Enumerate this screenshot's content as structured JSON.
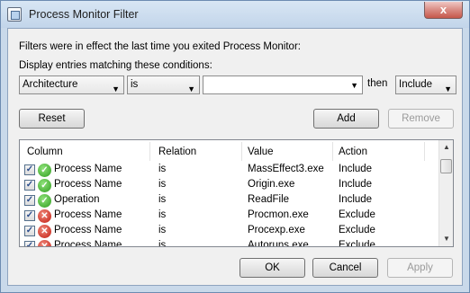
{
  "window": {
    "title": "Process Monitor Filter",
    "close_label": "x"
  },
  "intro_text": "Filters were in effect the last time you exited Process Monitor:",
  "display_label": "Display entries matching these conditions:",
  "condition": {
    "column": "Architecture",
    "relation": "is",
    "value": "",
    "then_label": "then",
    "action": "Include"
  },
  "buttons": {
    "reset": "Reset",
    "add": "Add",
    "remove": "Remove",
    "ok": "OK",
    "cancel": "Cancel",
    "apply": "Apply"
  },
  "table": {
    "headers": [
      "Column",
      "Relation",
      "Value",
      "Action"
    ],
    "rows": [
      {
        "column": "Process Name",
        "relation": "is",
        "value": "MassEffect3.exe",
        "action": "Include",
        "checked": true,
        "status": "include"
      },
      {
        "column": "Process Name",
        "relation": "is",
        "value": "Origin.exe",
        "action": "Include",
        "checked": true,
        "status": "include"
      },
      {
        "column": "Operation",
        "relation": "is",
        "value": "ReadFile",
        "action": "Include",
        "checked": true,
        "status": "include"
      },
      {
        "column": "Process Name",
        "relation": "is",
        "value": "Procmon.exe",
        "action": "Exclude",
        "checked": true,
        "status": "exclude"
      },
      {
        "column": "Process Name",
        "relation": "is",
        "value": "Procexp.exe",
        "action": "Exclude",
        "checked": true,
        "status": "exclude"
      },
      {
        "column": "Process Name",
        "relation": "is",
        "value": "Autoruns.exe",
        "action": "Exclude",
        "checked": true,
        "status": "exclude"
      }
    ]
  },
  "glyphs": {
    "check": "✓",
    "include": "✓",
    "exclude": "✕",
    "dropdown": "▼",
    "scroll_up": "▲",
    "scroll_down": "▼"
  }
}
